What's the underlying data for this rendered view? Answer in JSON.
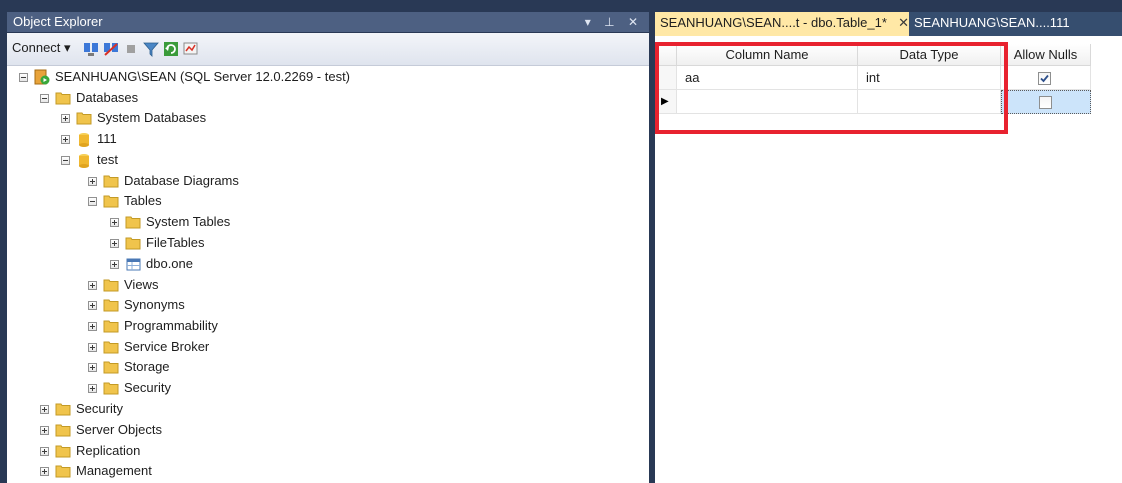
{
  "object_explorer": {
    "title": "Object Explorer",
    "title_controls": "▾ ⊥ ✕",
    "toolbar": {
      "connect_label": "Connect ▾",
      "icons": [
        "connect-object-explorer-icon",
        "disconnect-icon",
        "stop-icon",
        "filter-icon",
        "refresh-icon",
        "activity-monitor-icon"
      ]
    },
    "tree": {
      "server": "SEANHUANG\\SEAN (SQL Server 12.0.2269 - test)",
      "databases": "Databases",
      "system_databases": "System Databases",
      "db_111": "111",
      "db_test": "test",
      "database_diagrams": "Database Diagrams",
      "tables": "Tables",
      "system_tables": "System Tables",
      "file_tables": "FileTables",
      "dbo_one": "dbo.one",
      "views": "Views",
      "synonyms": "Synonyms",
      "programmability": "Programmability",
      "service_broker": "Service Broker",
      "storage": "Storage",
      "security_db": "Security",
      "security": "Security",
      "server_objects": "Server Objects",
      "replication": "Replication",
      "management": "Management"
    }
  },
  "tabs": {
    "active": "SEANHUANG\\SEAN....t - dbo.Table_1*",
    "active_close": "✕",
    "other": "SEANHUANG\\SEAN....111"
  },
  "grid": {
    "headers": {
      "column_name": "Column Name",
      "data_type": "Data Type",
      "allow_nulls": "Allow Nulls"
    },
    "rows": [
      {
        "column_name": "aa",
        "data_type": "int",
        "allow_nulls": true
      },
      {
        "column_name": "",
        "data_type": "",
        "allow_nulls": false
      }
    ],
    "current_row_marker": "▶"
  },
  "colors": {
    "chrome": "#293955",
    "active_tab": "#ffe8a6",
    "highlight_box": "#e8222f",
    "selected_cell": "#cce4fa"
  }
}
